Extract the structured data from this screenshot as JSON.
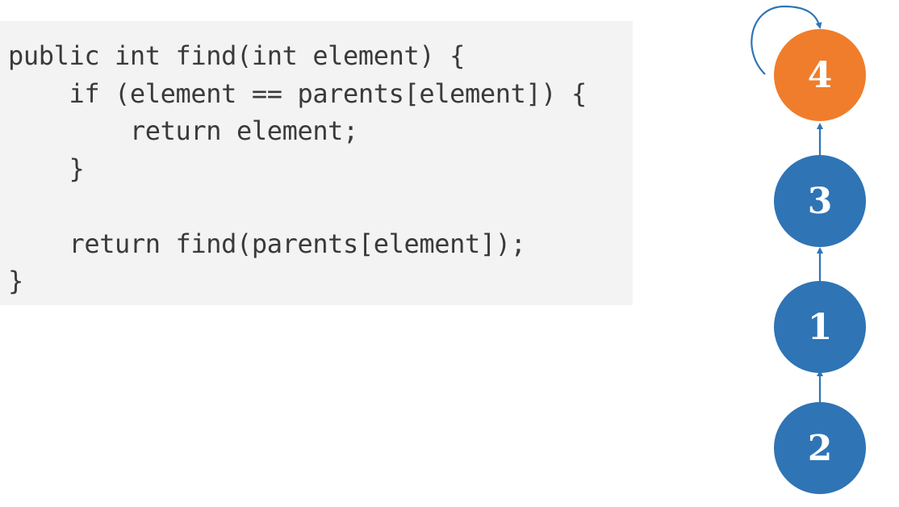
{
  "code": {
    "lines": [
      "public int find(int element) {",
      "    if (element == parents[element]) {",
      "        return element;",
      "    }",
      "",
      "    return find(parents[element]);",
      "}"
    ]
  },
  "tree": {
    "nodes": [
      {
        "label": "4",
        "color": "#ef7d2b",
        "is_root": true
      },
      {
        "label": "3",
        "color": "#2f74b5",
        "is_root": false
      },
      {
        "label": "1",
        "color": "#2f74b5",
        "is_root": false
      },
      {
        "label": "2",
        "color": "#2f74b5",
        "is_root": false
      }
    ],
    "edges": [
      {
        "from": "3",
        "to": "4"
      },
      {
        "from": "1",
        "to": "3"
      },
      {
        "from": "2",
        "to": "1"
      },
      {
        "from": "4",
        "to": "4",
        "self_loop": true
      }
    ],
    "edge_color": "#2f74b5"
  }
}
